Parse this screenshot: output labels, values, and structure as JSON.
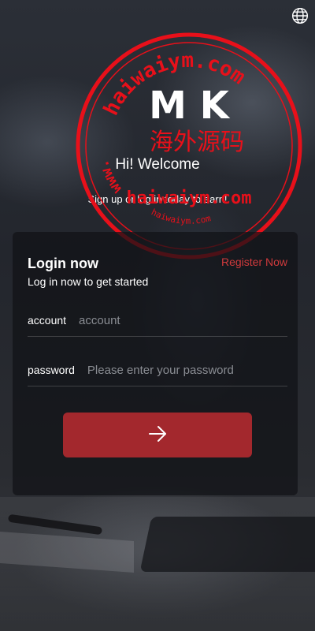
{
  "hero": {
    "title": "Hi! Welcome",
    "subtitle": "Sign up or log in today to earn!"
  },
  "login": {
    "title": "Login now",
    "subtitle": "Log in now to get started",
    "register_link": "Register Now",
    "account": {
      "label": "account",
      "placeholder": "account"
    },
    "password": {
      "label": "password",
      "placeholder": "Please enter your password"
    },
    "submit_icon": "arrow-right-icon"
  },
  "header": {
    "language_icon": "globe-icon"
  },
  "watermark": {
    "letters": "M K",
    "chinese": "海外源码",
    "site": "haiwaiym.com",
    "arc_top": "haiwaiym.com",
    "arc_left": "www.",
    "arc_bottom": "haiwaiym.com"
  },
  "colors": {
    "accent": "#d03a3c",
    "button": "#a3282d",
    "watermark": "#e8101a"
  }
}
